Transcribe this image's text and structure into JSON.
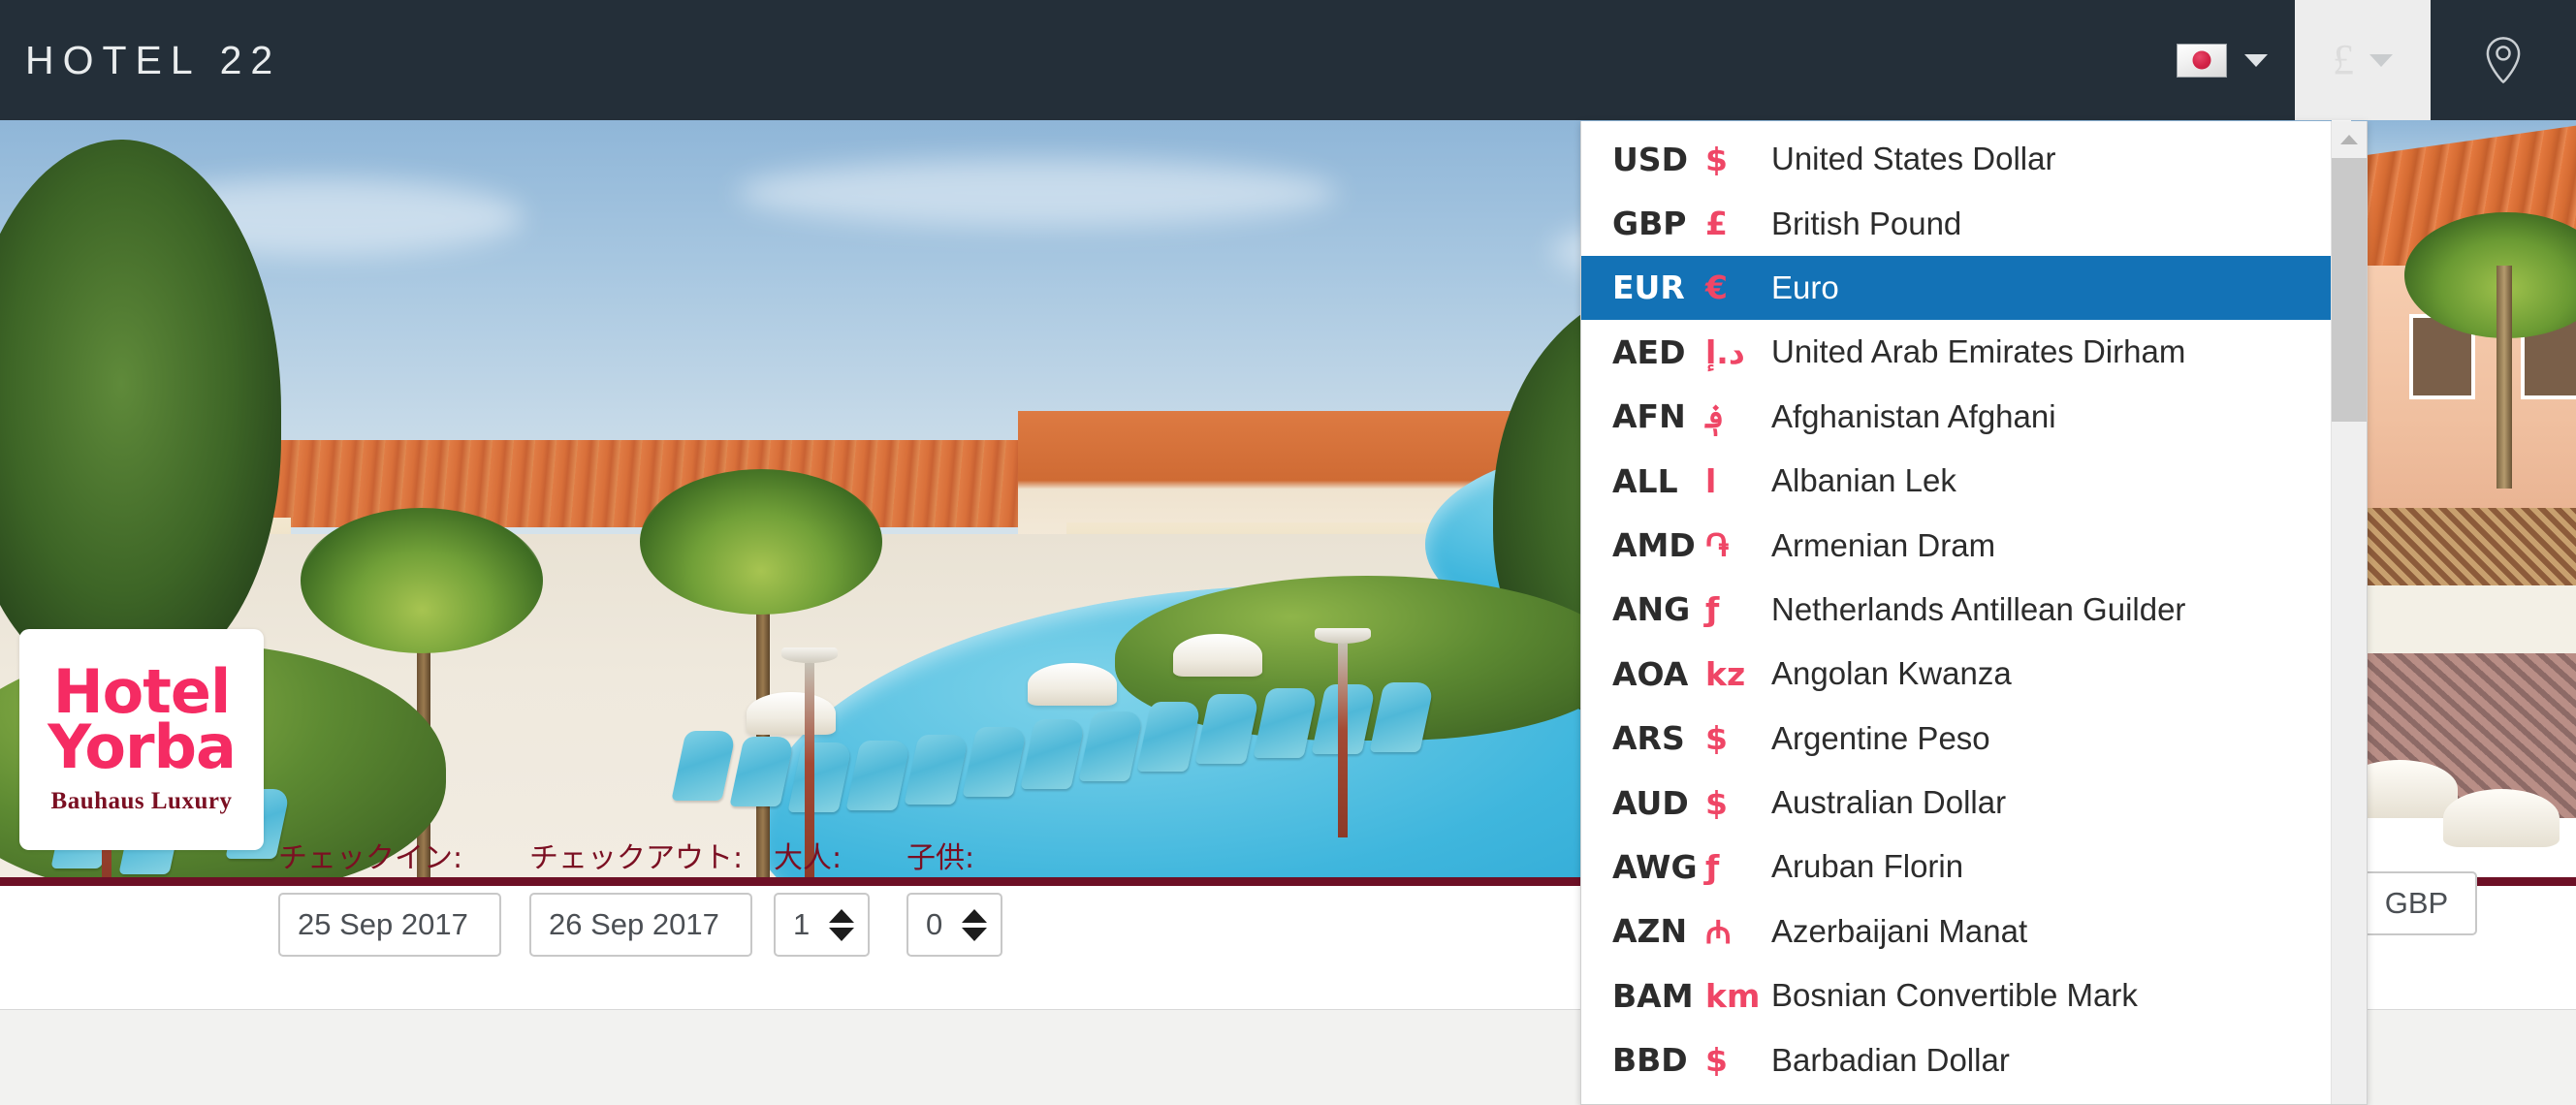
{
  "header": {
    "brand": "HOTEL 22",
    "language_button": {
      "name": "language-selector",
      "flag": "jp-flag-icon",
      "caret": "chevron-down-icon"
    },
    "currency_button": {
      "symbol": "£",
      "caret": "chevron-down-icon"
    },
    "location_button": {
      "icon": "map-pin-icon"
    }
  },
  "logo_card": {
    "line1": "Hotel",
    "line2": "Yorba",
    "tagline": "Bauhaus Luxury",
    "brand_color": "#f52b63",
    "tagline_color": "#7b0f22"
  },
  "booking": {
    "checkin": {
      "label": "チェックイン:",
      "value": "25 Sep 2017"
    },
    "checkout": {
      "label": "チェックアウト:",
      "value": "26 Sep 2017"
    },
    "adults": {
      "label": "大人:",
      "value": "1"
    },
    "children": {
      "label": "子供:",
      "value": "0"
    },
    "currency": {
      "value": "GBP"
    }
  },
  "currency_dropdown": {
    "selected": "EUR",
    "highlight_color": "#1372b6",
    "symbol_color": "#ef4666",
    "scroll_up_icon": "chevron-up-icon",
    "items": [
      {
        "code": "USD",
        "symbol": "$",
        "name": "United States Dollar"
      },
      {
        "code": "GBP",
        "symbol": "£",
        "name": "British Pound"
      },
      {
        "code": "EUR",
        "symbol": "€",
        "name": "Euro",
        "selected": true
      },
      {
        "code": "AED",
        "symbol": "د.إ",
        "name": "United Arab Emirates Dirham"
      },
      {
        "code": "AFN",
        "symbol": "؋",
        "name": "Afghanistan Afghani"
      },
      {
        "code": "ALL",
        "symbol": "l",
        "name": "Albanian Lek"
      },
      {
        "code": "AMD",
        "symbol": "֏",
        "name": "Armenian Dram"
      },
      {
        "code": "ANG",
        "symbol": "ƒ",
        "name": "Netherlands Antillean Guilder"
      },
      {
        "code": "AOA",
        "symbol": "kz",
        "name": "Angolan Kwanza"
      },
      {
        "code": "ARS",
        "symbol": "$",
        "name": "Argentine Peso"
      },
      {
        "code": "AUD",
        "symbol": "$",
        "name": "Australian Dollar"
      },
      {
        "code": "AWG",
        "symbol": "ƒ",
        "name": "Aruban Florin"
      },
      {
        "code": "AZN",
        "symbol": "₼",
        "name": "Azerbaijani Manat"
      },
      {
        "code": "BAM",
        "symbol": "km",
        "name": "Bosnian Convertible Mark"
      },
      {
        "code": "BBD",
        "symbol": "$",
        "name": "Barbadian Dollar"
      }
    ]
  }
}
